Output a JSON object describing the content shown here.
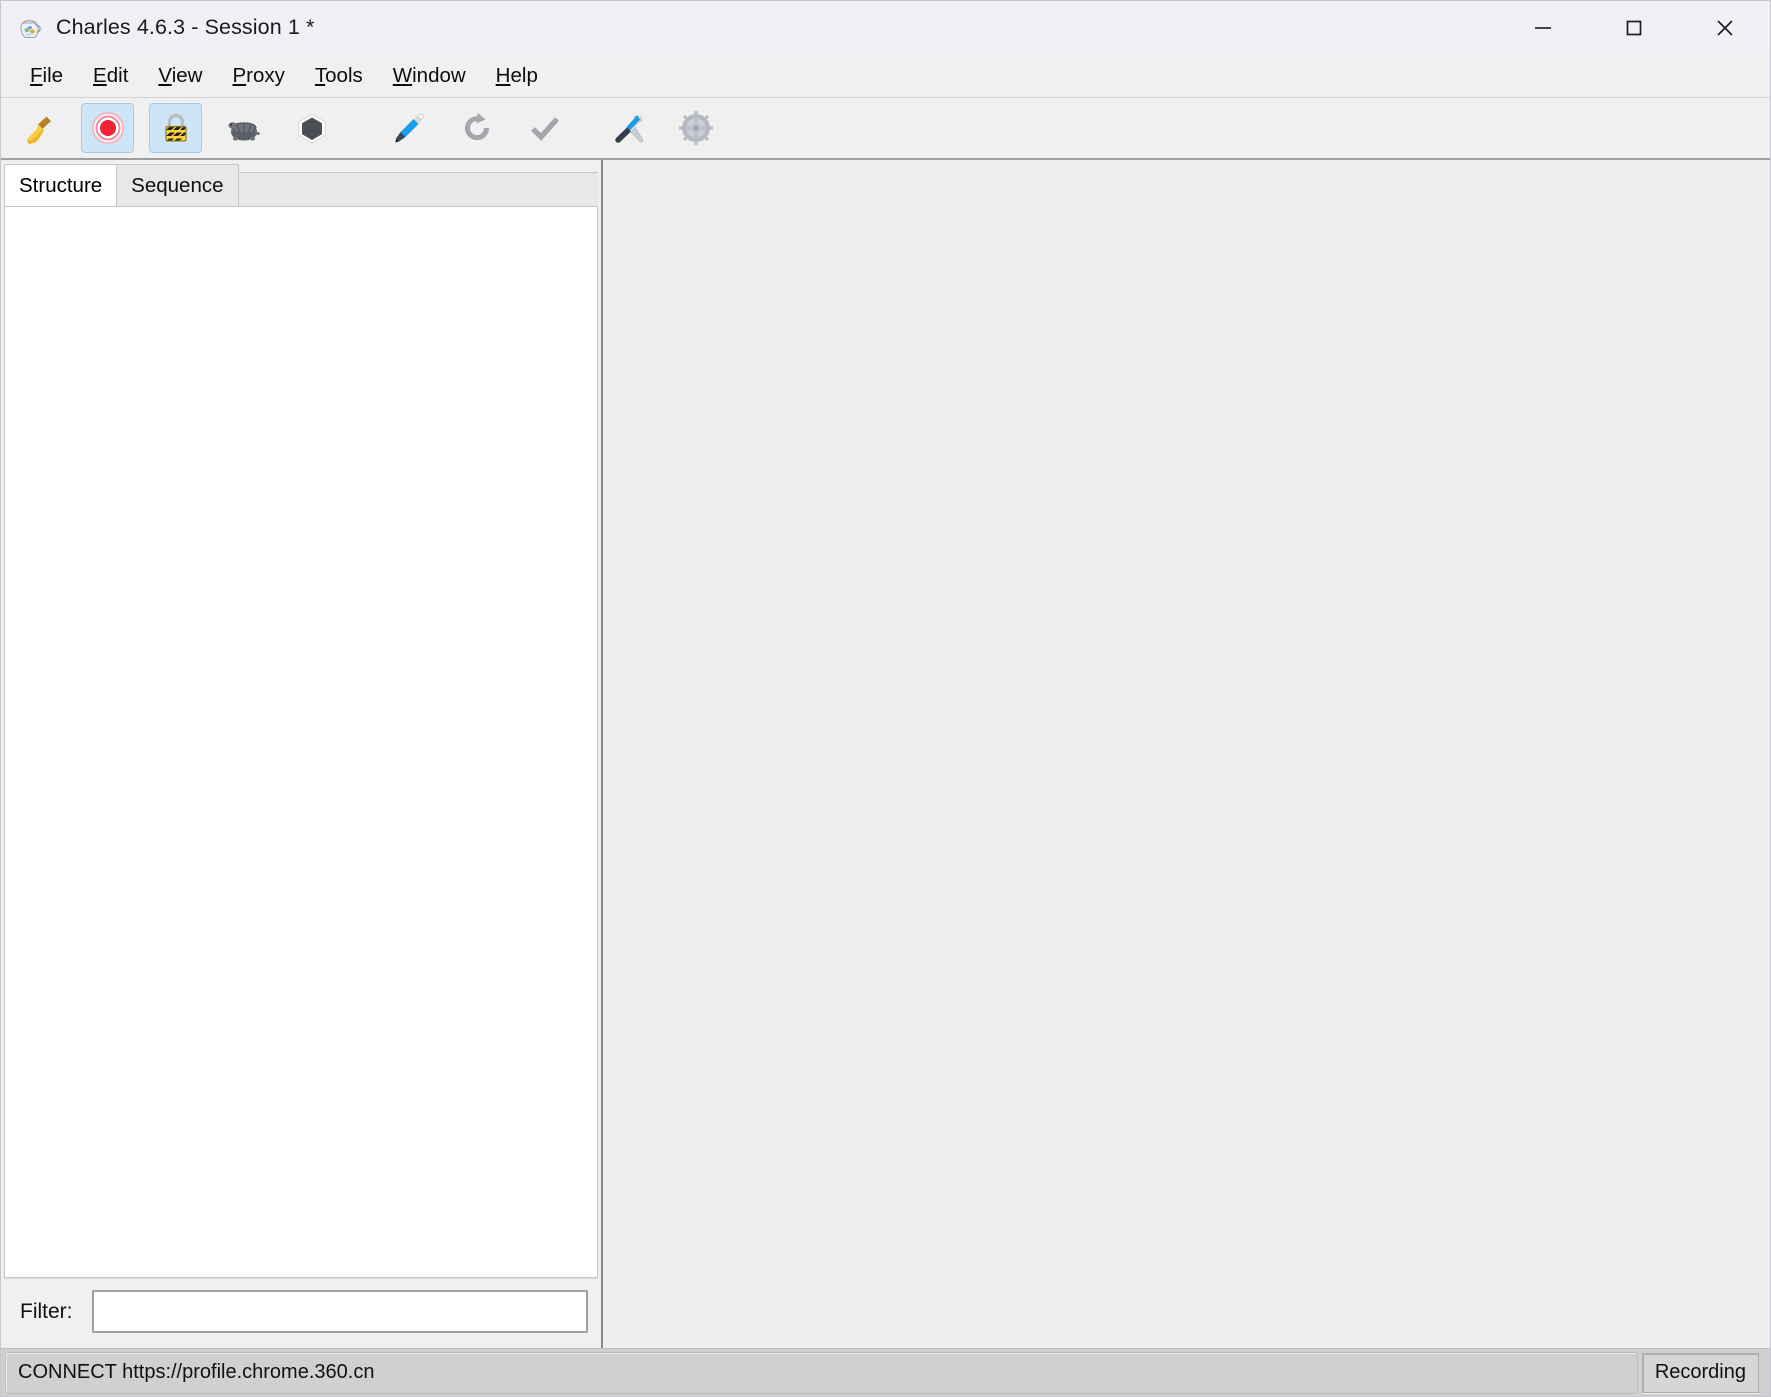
{
  "window": {
    "title": "Charles 4.6.3 - Session 1 *",
    "app_icon": "jug-icon",
    "controls": {
      "minimize": "minimize-icon",
      "maximize": "maximize-icon",
      "close": "close-icon"
    }
  },
  "menubar": {
    "items": [
      {
        "label": "File",
        "mnemonic": "F",
        "rest": "ile"
      },
      {
        "label": "Edit",
        "mnemonic": "E",
        "rest": "dit"
      },
      {
        "label": "View",
        "mnemonic": "V",
        "rest": "iew"
      },
      {
        "label": "Proxy",
        "mnemonic": "P",
        "rest": "roxy"
      },
      {
        "label": "Tools",
        "mnemonic": "T",
        "rest": "ools"
      },
      {
        "label": "Window",
        "mnemonic": "W",
        "rest": "indow"
      },
      {
        "label": "Help",
        "mnemonic": "H",
        "rest": "elp"
      }
    ]
  },
  "toolbar": {
    "buttons": [
      {
        "name": "clear-session-button",
        "icon": "broom-icon",
        "selected": false
      },
      {
        "name": "record-button",
        "icon": "record-icon",
        "selected": true
      },
      {
        "name": "ssl-proxying-button",
        "icon": "padlock-icon",
        "selected": true
      },
      {
        "name": "throttle-button",
        "icon": "turtle-icon",
        "selected": false
      },
      {
        "name": "breakpoints-button",
        "icon": "hexagon-icon",
        "selected": false
      },
      {
        "name": "compose-button",
        "icon": "pen-icon",
        "selected": false
      },
      {
        "name": "repeat-button",
        "icon": "repeat-arrow-icon",
        "selected": false
      },
      {
        "name": "validate-button",
        "icon": "checkmark-icon",
        "selected": false
      },
      {
        "name": "tools-button",
        "icon": "tools-icon",
        "selected": false
      },
      {
        "name": "settings-button",
        "icon": "gear-icon",
        "selected": false
      }
    ]
  },
  "left_pane": {
    "tabs": [
      {
        "label": "Structure",
        "active": true
      },
      {
        "label": "Sequence",
        "active": false
      }
    ],
    "tree_items": [],
    "filter": {
      "label": "Filter:",
      "value": "",
      "placeholder": ""
    }
  },
  "right_pane": {
    "content": ""
  },
  "statusbar": {
    "message": "CONNECT https://profile.chrome.360.cn",
    "recording_label": "Recording"
  },
  "colors": {
    "titlebar_bg": "#f2f0f7",
    "chrome_bg": "#f0f0f0",
    "content_bg": "#eeeeee",
    "statusbar_bg": "#d0d0d0",
    "selected_toolbtn_bg": "#cde5f7",
    "selected_toolbtn_border": "#a5cbe8",
    "accent_record": "#ee2233",
    "splitter": "#868686"
  }
}
